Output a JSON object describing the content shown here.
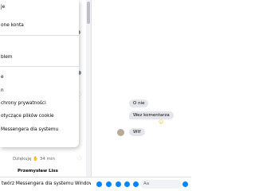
{
  "menu": {
    "items": [
      {
        "label": "je"
      },
      {
        "label": "one konta"
      },
      {
        "label": "blem"
      },
      {
        "label": "e"
      },
      {
        "label": "n"
      },
      {
        "label": "chrony prywatności"
      },
      {
        "label": "otyczące plików cookie"
      },
      {
        "label": "Messengera dla systemu"
      }
    ]
  },
  "background_list": {
    "preview_text": "Dziękuję ✋ 34 min",
    "partial_name": "Przemysław Liss"
  },
  "chat": {
    "messages": [
      {
        "text": "O nie"
      },
      {
        "text": "Wez komentarza"
      },
      {
        "text": "Wtf"
      }
    ]
  },
  "bottom_bar": {
    "install_label": "twórz Messengera dla systemu Windows",
    "composer_placeholder": "Aa"
  },
  "colors": {
    "accent": "#0084ff",
    "bubble": "#e4e6eb",
    "divider": "#dadde1"
  },
  "icons": [
    "camera-icon",
    "image-icon",
    "sticker-icon",
    "gif-icon",
    "emoji-icon",
    "pin-icon"
  ]
}
